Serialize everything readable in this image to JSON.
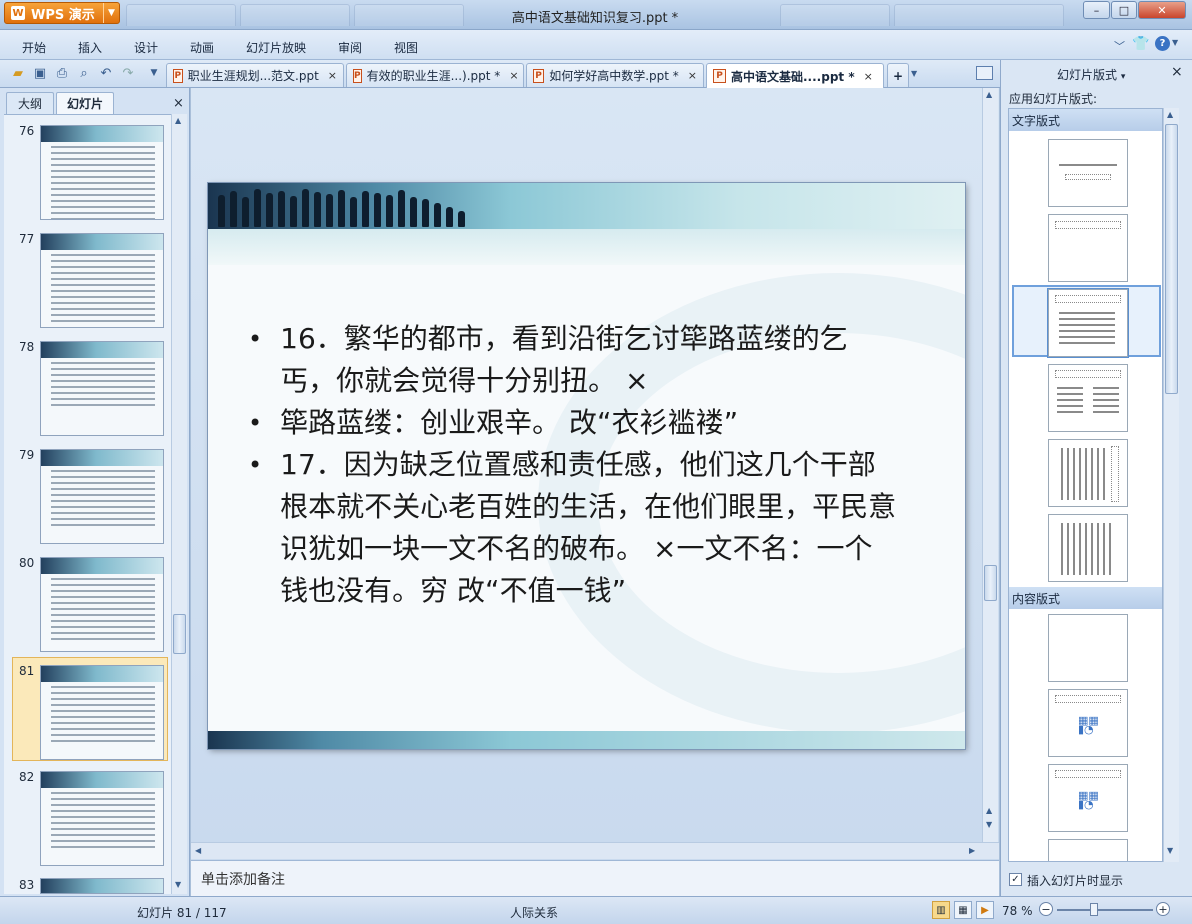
{
  "app": {
    "brand": "WPS 演示",
    "window_title": "高中语文基础知识复习.ppt *"
  },
  "window_controls": {
    "minimize": "–",
    "maximize": "□",
    "close": "✕"
  },
  "menu": [
    "开始",
    "插入",
    "设计",
    "动画",
    "幻灯片放映",
    "审阅",
    "视图"
  ],
  "doc_tabs": [
    {
      "label": "职业生涯规划...范文.ppt",
      "close": "×"
    },
    {
      "label": "有效的职业生涯...).ppt *",
      "close": "×"
    },
    {
      "label": "如何学好高中数学.ppt *",
      "close": "×"
    },
    {
      "label": "高中语文基础....ppt *",
      "close": "×"
    }
  ],
  "new_tab": "+",
  "left_pane": {
    "tabs": [
      "大纲",
      "幻灯片"
    ],
    "close": "×",
    "slides": [
      {
        "num": "76"
      },
      {
        "num": "77"
      },
      {
        "num": "78"
      },
      {
        "num": "79"
      },
      {
        "num": "80"
      },
      {
        "num": "81",
        "selected": true
      },
      {
        "num": "82"
      },
      {
        "num": "83"
      }
    ]
  },
  "slide": {
    "bullets": [
      {
        "text": "16．繁华的都市，看到沿街乞讨筚路蓝缕的乞丐，你就会觉得十分别扭。        ×"
      },
      {
        "text": "筚路蓝缕：创业艰辛。              改“衣衫褴褛”"
      },
      {
        "text": "17．因为缺乏位置感和责任感，他们这几个干部根本就不关心老百姓的生活，在他们眼里，平民意识犹如一块一文不名的破布。 ×一文不名：一个钱也没有。穷                    改“不值一钱”"
      }
    ]
  },
  "notes": {
    "placeholder": "单击添加备注"
  },
  "right_pane": {
    "title": "幻灯片版式",
    "title_arrow": "▾",
    "close": "×",
    "apply_label": "应用幻灯片版式:",
    "section_text": "文字版式",
    "section_content": "内容版式",
    "checkbox_label": "插入幻灯片时显示",
    "checkbox_checked": true
  },
  "status": {
    "slide_counter": "幻灯片 81 / 117",
    "theme": "人际关系",
    "zoom": "78 %"
  },
  "colors": {
    "accent": "#e0700c",
    "chrome": "#c9dbf0",
    "selection": "#fbe9ba"
  }
}
